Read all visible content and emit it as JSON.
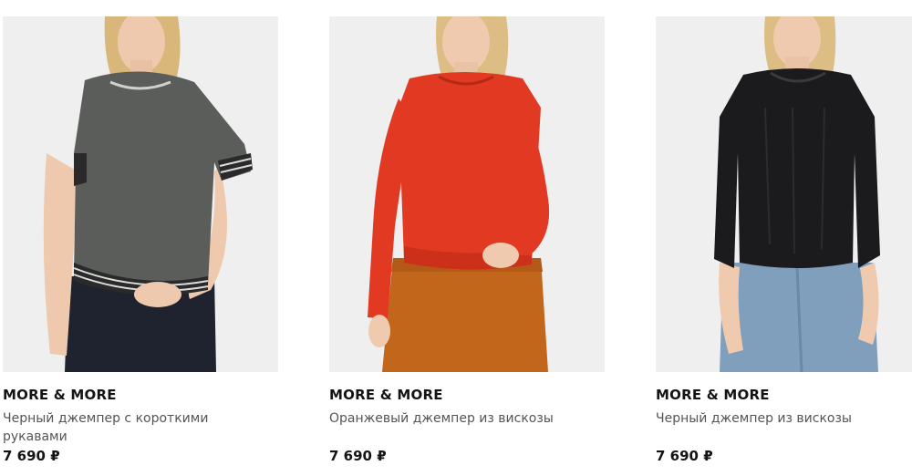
{
  "products": [
    {
      "brand": "MORE & MORE",
      "title": "Черный джемпер с короткими рукавами",
      "price": "7 690 ₽"
    },
    {
      "brand": "MORE & MORE",
      "title": "Оранжевый джемпер из вискозы",
      "price": "7 690 ₽"
    },
    {
      "brand": "MORE & MORE",
      "title": "Черный джемпер из вискозы",
      "price": "7 690 ₽"
    }
  ],
  "colors": {
    "photo_bg": "#efefef",
    "grey_sweater": "#5b5d5a",
    "orange_sweater": "#e23a22",
    "skirt": "#c2661c",
    "black_sweater": "#1b1b1d",
    "jeans": "#7f9fbd"
  }
}
